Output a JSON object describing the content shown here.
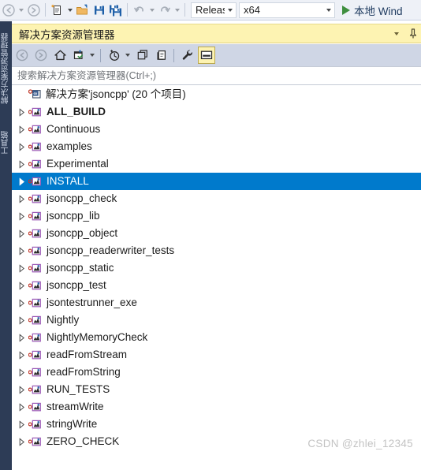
{
  "toolbar": {
    "nav_back": "navigate-backward",
    "nav_forward": "navigate-forward",
    "new_item": "new-item",
    "open_file": "open-file",
    "save": "save",
    "save_all": "save-all",
    "undo": "undo",
    "redo": "redo",
    "config": {
      "value": "Releas",
      "full": "Release"
    },
    "platform": {
      "value": "x64"
    },
    "run": {
      "label": "本地 Wind",
      "full": "本地 Windows 调试器"
    }
  },
  "left_dock": {
    "tabs": [
      {
        "label": "解决方案资源管理器"
      },
      {
        "label": "工具箱"
      }
    ]
  },
  "solution_explorer": {
    "title": "解决方案资源管理器",
    "title_chevron": "chevron-down-icon",
    "title_pin": "pin-icon",
    "toolbar_buttons": [
      {
        "name": "back-button",
        "label": "后退"
      },
      {
        "name": "forward-button",
        "label": "前进"
      },
      {
        "name": "home-button",
        "label": "主页"
      },
      {
        "name": "pending-changes-button",
        "label": "挂起的更改筛选器"
      },
      {
        "name": "sync-with-editor-button",
        "label": "与活动文档同步"
      },
      {
        "name": "refresh-button",
        "label": "刷新"
      },
      {
        "name": "show-all-files-button",
        "label": "显示所有文件"
      },
      {
        "name": "properties-button",
        "label": "属性"
      },
      {
        "name": "preview-pane-button",
        "label": "预览选定项"
      }
    ],
    "search": {
      "placeholder": "搜索解决方案资源管理器(Ctrl+;)",
      "value": ""
    },
    "tree": {
      "root": {
        "label": "解决方案'jsoncpp' (20 个项目)",
        "icon": "solution-icon",
        "modified": true
      },
      "items": [
        {
          "label": "ALL_BUILD",
          "bold": true,
          "selected": false
        },
        {
          "label": "Continuous",
          "bold": false,
          "selected": false
        },
        {
          "label": "examples",
          "bold": false,
          "selected": false
        },
        {
          "label": "Experimental",
          "bold": false,
          "selected": false
        },
        {
          "label": "INSTALL",
          "bold": false,
          "selected": true
        },
        {
          "label": "jsoncpp_check",
          "bold": false,
          "selected": false
        },
        {
          "label": "jsoncpp_lib",
          "bold": false,
          "selected": false
        },
        {
          "label": "jsoncpp_object",
          "bold": false,
          "selected": false
        },
        {
          "label": "jsoncpp_readerwriter_tests",
          "bold": false,
          "selected": false
        },
        {
          "label": "jsoncpp_static",
          "bold": false,
          "selected": false
        },
        {
          "label": "jsoncpp_test",
          "bold": false,
          "selected": false
        },
        {
          "label": "jsontestrunner_exe",
          "bold": false,
          "selected": false
        },
        {
          "label": "Nightly",
          "bold": false,
          "selected": false
        },
        {
          "label": "NightlyMemoryCheck",
          "bold": false,
          "selected": false
        },
        {
          "label": "readFromStream",
          "bold": false,
          "selected": false
        },
        {
          "label": "readFromString",
          "bold": false,
          "selected": false
        },
        {
          "label": "RUN_TESTS",
          "bold": false,
          "selected": false
        },
        {
          "label": "streamWrite",
          "bold": false,
          "selected": false
        },
        {
          "label": "stringWrite",
          "bold": false,
          "selected": false
        },
        {
          "label": "ZERO_CHECK",
          "bold": false,
          "selected": false
        }
      ]
    }
  },
  "watermark": {
    "text": "CSDN @zhlei_12345"
  },
  "colors": {
    "accent_selection": "#007acc",
    "title_highlight": "#fdf3b2",
    "panel_toolbar": "#cfd6e5",
    "dock_strip": "#2d3c56",
    "toolbar_bg": "#eef1f7",
    "run_green": "#3f8f3f"
  }
}
